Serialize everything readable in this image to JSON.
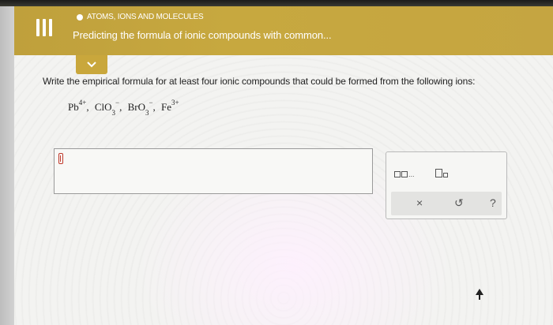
{
  "header": {
    "topic": "ATOMS, IONS AND MOLECULES",
    "lesson_title": "Predicting the formula of ionic compounds with common..."
  },
  "icons": {
    "menu": "hamburger-menu-icon",
    "collapse": "chevron-down-icon",
    "pointer": "mouse-pointer-icon"
  },
  "question": {
    "prompt": "Write the empirical formula for at least four ionic compounds that could be formed from the following ions:",
    "ions": [
      {
        "base": "Pb",
        "sub": "",
        "sup": "4+"
      },
      {
        "base": "ClO",
        "sub": "3",
        "sup": "−"
      },
      {
        "base": "BrO",
        "sub": "3",
        "sup": "−"
      },
      {
        "base": "Fe",
        "sub": "",
        "sup": "3+"
      }
    ],
    "separator": ","
  },
  "answer": {
    "value": ""
  },
  "toolbox": {
    "subscript_template_label": "□,□,...",
    "subscript_button_label": "□₀",
    "clear_label": "×",
    "undo_label": "↺",
    "help_label": "?"
  },
  "colors": {
    "header": "#c7a83f",
    "content_bg": "#f1f1ef",
    "accent_red": "#c0392b"
  }
}
